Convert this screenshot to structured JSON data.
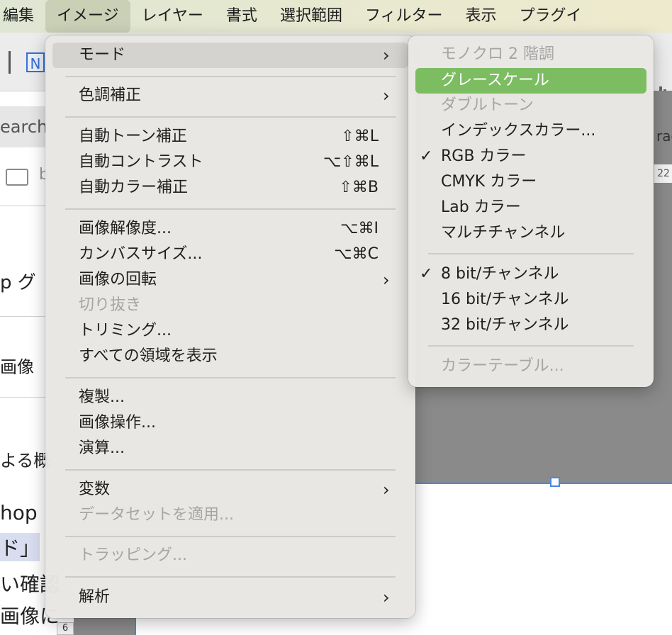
{
  "menubar": {
    "items": [
      "編集",
      "イメージ",
      "レイヤー",
      "書式",
      "選択範囲",
      "フィルター",
      "表示",
      "プラグイ"
    ]
  },
  "image_menu": {
    "mode": "モード",
    "adjust": "色調補正",
    "auto_tone": "自動トーン補正",
    "auto_tone_sc": "⇧⌘L",
    "auto_contrast": "自動コントラスト",
    "auto_contrast_sc": "⌥⇧⌘L",
    "auto_color": "自動カラー補正",
    "auto_color_sc": "⇧⌘B",
    "image_size": "画像解像度...",
    "image_size_sc": "⌥⌘I",
    "canvas_size": "カンバスサイズ...",
    "canvas_size_sc": "⌥⌘C",
    "rotation": "画像の回転",
    "crop": "切り抜き",
    "trim": "トリミング...",
    "reveal_all": "すべての領域を表示",
    "duplicate": "複製...",
    "apply_image": "画像操作...",
    "calculations": "演算...",
    "variables": "変数",
    "apply_dataset": "データセットを適用...",
    "trap": "トラッピング...",
    "analysis": "解析",
    "arrow": "›"
  },
  "mode_submenu": {
    "bitmap": "モノクロ 2 階調",
    "grayscale": "グレースケール",
    "duotone": "ダブルトーン",
    "indexed": "インデックスカラー...",
    "rgb": "RGB カラー",
    "cmyk": "CMYK カラー",
    "lab": "Lab カラー",
    "multichannel": "マルチチャンネル",
    "bit8": "8 bit/チャンネル",
    "bit16": "16 bit/チャンネル",
    "bit32": "32 bit/チャンネル",
    "color_table": "カラーテーブル...",
    "check": "✓"
  },
  "background": {
    "n_badge": "N",
    "search_fragment": "earch",
    "folder_letter": "b",
    "text_p": "p グ",
    "text_image": "画像",
    "text_yoru": "よる概",
    "text_hop": "hop",
    "text_do": "ド」",
    "text_kakunin": "い確認",
    "text_gazou": "画像に",
    "ruler_22": "22",
    "text_rac": "rac",
    "ruler_6": "6"
  },
  "colors": {
    "accent_selected": "#7cbd62",
    "menubar_bg": "#e6e8d0",
    "canvas_gray": "#8a8a8a",
    "selection_blue": "#4a86e8"
  }
}
